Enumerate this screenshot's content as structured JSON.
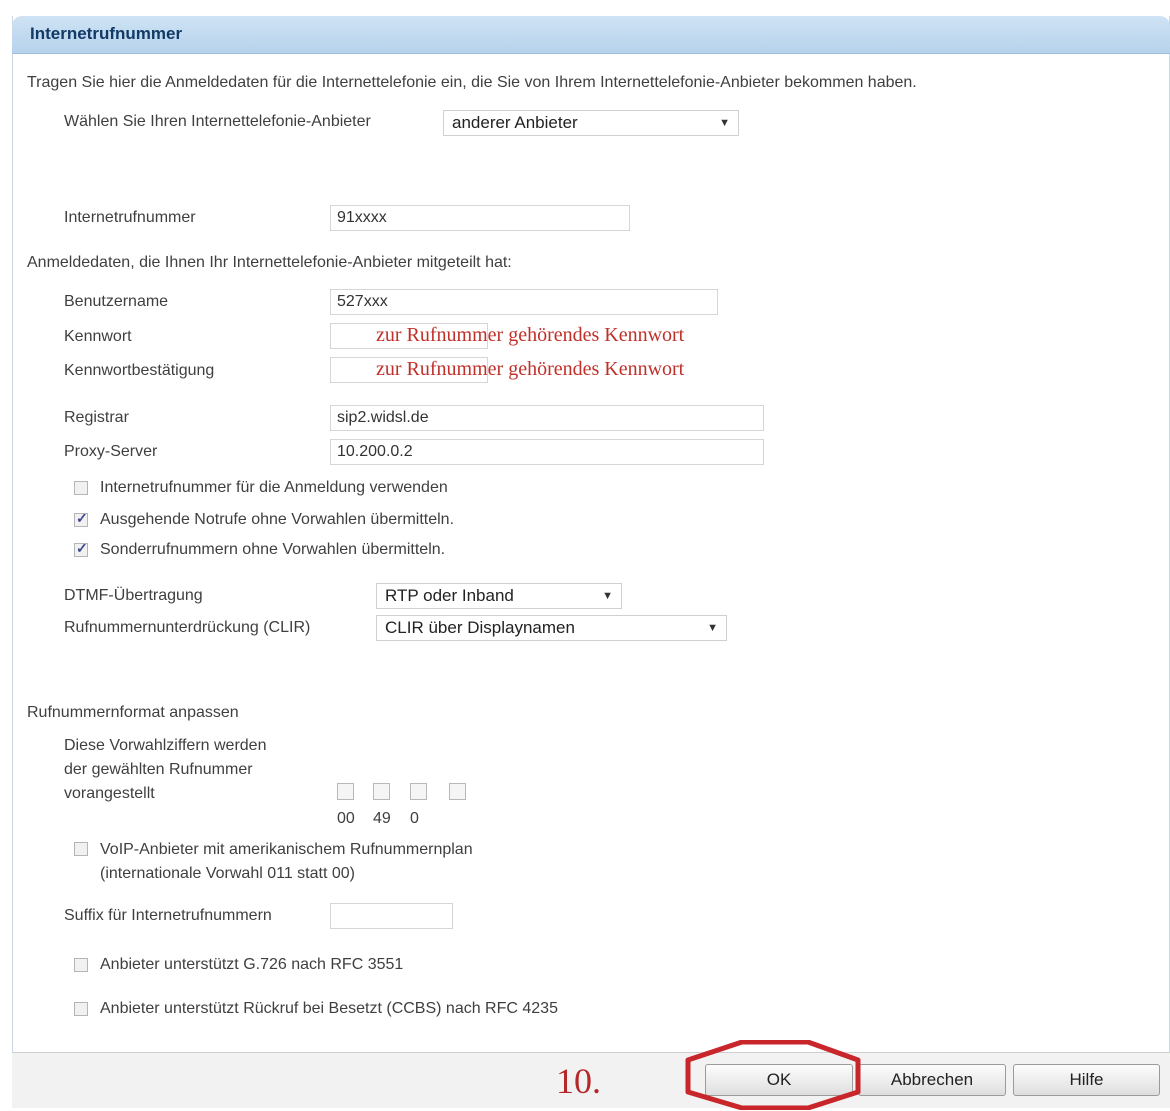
{
  "header": {
    "title": "Internetrufnummer"
  },
  "intro_text": "Tragen Sie hier die Anmeldedaten für die Internettelefonie ein, die Sie von Ihrem Internettelefonie-Anbieter bekommen haben.",
  "provider": {
    "label": "Wählen Sie Ihren Internettelefonie-Anbieter",
    "value": "anderer Anbieter"
  },
  "number": {
    "label": "Internetrufnummer",
    "value": "91xxxx"
  },
  "credentials_heading": "Anmeldedaten, die Ihnen Ihr Internettelefonie-Anbieter mitgeteilt hat:",
  "username": {
    "label": "Benutzername",
    "value": "527xxx"
  },
  "password": {
    "label": "Kennwort",
    "hint": "zur Rufnummer gehörendes Kennwort"
  },
  "password_confirm": {
    "label": "Kennwortbestätigung",
    "hint": "zur Rufnummer gehörendes Kennwort"
  },
  "registrar": {
    "label": "Registrar",
    "value": "sip2.widsl.de"
  },
  "proxy": {
    "label": "Proxy-Server",
    "value": "10.200.0.2"
  },
  "checkboxes": [
    {
      "label": "Internetrufnummer für die Anmeldung verwenden",
      "checked": false
    },
    {
      "label": "Ausgehende Notrufe ohne Vorwahlen übermitteln.",
      "checked": true
    },
    {
      "label": "Sonderrufnummern ohne Vorwahlen übermitteln.",
      "checked": true
    }
  ],
  "dtmf": {
    "label": "DTMF-Übertragung",
    "value": "RTP oder Inband"
  },
  "clir": {
    "label": "Rufnummernunterdrückung (CLIR)",
    "value": "CLIR über Displaynamen"
  },
  "format_heading": "Rufnummernformat anpassen",
  "prefix": {
    "label_lines": [
      "Diese Vorwahlziffern werden",
      "der gewählten Rufnummer",
      "vorangestellt"
    ],
    "digits": [
      "00",
      "49",
      "0",
      ""
    ]
  },
  "voip_us": {
    "line1": "VoIP-Anbieter mit amerikanischem Rufnummernplan",
    "line2": "(internationale Vorwahl 011 statt 00)",
    "checked": false
  },
  "suffix": {
    "label": "Suffix für Internetrufnummern",
    "value": ""
  },
  "g726": {
    "label": "Anbieter unterstützt G.726 nach RFC 3551",
    "checked": false
  },
  "ccbs": {
    "label": "Anbieter unterstützt Rückruf bei Besetzt (CCBS) nach RFC 4235",
    "checked": false
  },
  "footer": {
    "step_label": "10.",
    "ok": "OK",
    "cancel": "Abbrechen",
    "help": "Hilfe"
  },
  "colors": {
    "header_bg": "#b6d2ec",
    "header_text": "#123a66",
    "annotation_red": "#c0302a"
  }
}
